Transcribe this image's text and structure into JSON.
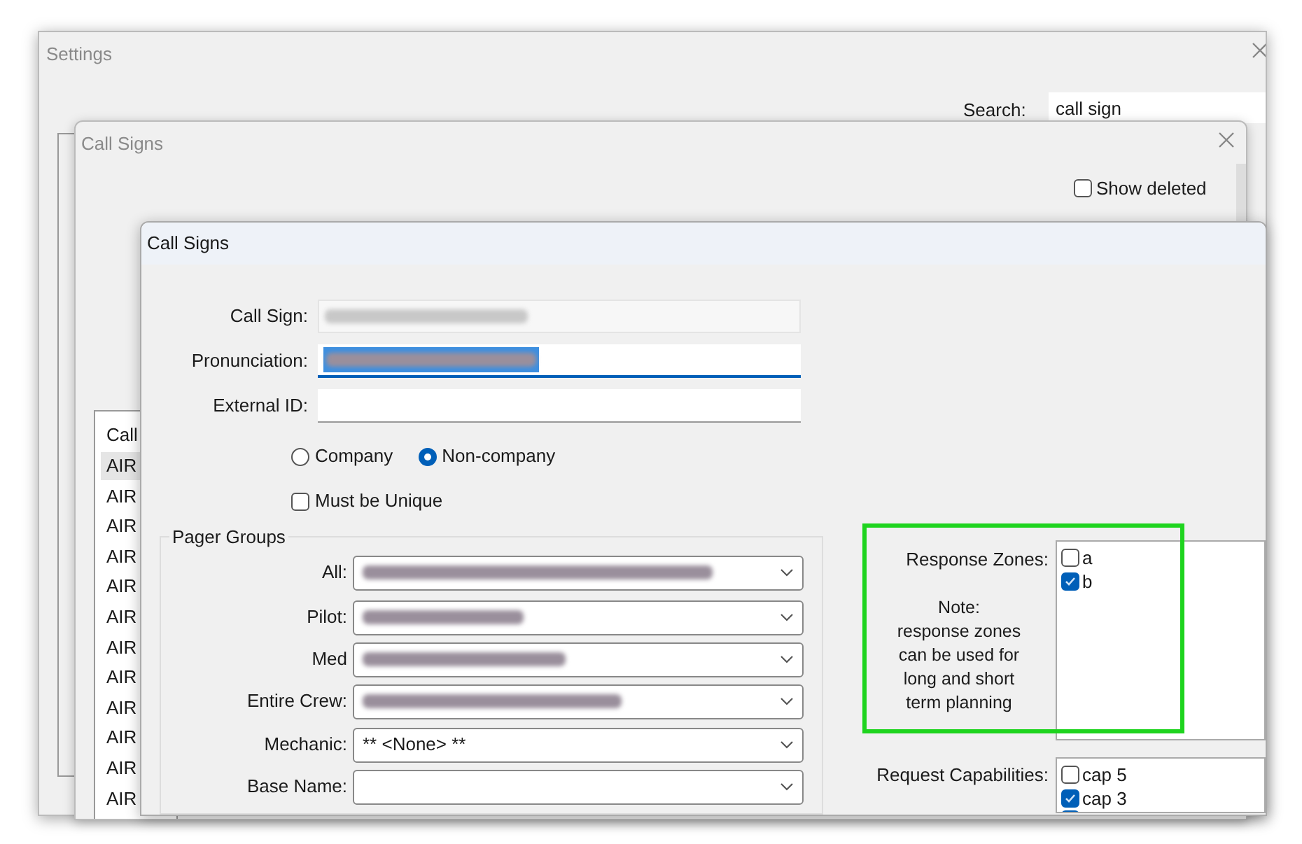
{
  "settings_window": {
    "title": "Settings",
    "search": {
      "label": "Search:",
      "value": "call sign"
    }
  },
  "call_signs_window": {
    "title": "Call Signs",
    "show_deleted": {
      "label": "Show deleted",
      "checked": false
    },
    "list": {
      "header": "Call",
      "rows": [
        {
          "text": "AIR",
          "selected": true
        },
        {
          "text": "AIR",
          "selected": false
        },
        {
          "text": "AIR",
          "selected": false
        },
        {
          "text": "AIR",
          "selected": false
        },
        {
          "text": "AIR",
          "selected": false
        },
        {
          "text": "AIR",
          "selected": false
        },
        {
          "text": "AIR",
          "selected": false
        },
        {
          "text": "AIR",
          "selected": false
        },
        {
          "text": "AIR",
          "selected": false
        },
        {
          "text": "AIR",
          "selected": false
        },
        {
          "text": "AIR",
          "selected": false
        },
        {
          "text": "AIR",
          "selected": false
        }
      ]
    }
  },
  "dialog": {
    "title": "Call Signs",
    "fields": [
      {
        "label": "Call Sign:",
        "kind": "readonly",
        "redacted": true
      },
      {
        "label": "Pronunciation:",
        "kind": "focused",
        "redacted": true
      },
      {
        "label": "External ID:",
        "kind": "text",
        "redacted": false
      }
    ],
    "ownership": [
      {
        "label": "Company",
        "selected": false
      },
      {
        "label": "Non-company",
        "selected": true
      }
    ],
    "must_be_unique": {
      "label": "Must be Unique",
      "checked": false
    },
    "pager_groups": {
      "title": "Pager Groups",
      "rows": [
        {
          "label": "All:",
          "redacted": true
        },
        {
          "label": "Pilot:",
          "redacted": true
        },
        {
          "label": "Med",
          "redacted": true
        },
        {
          "label": "Entire Crew:",
          "redacted": true
        },
        {
          "label": "Mechanic:",
          "value": "** <None> **"
        },
        {
          "label": "Base Name:"
        }
      ]
    },
    "response_zones": {
      "label": "Response Zones:",
      "note": "Note:\nresponse zones\ncan be used for\nlong and short\nterm planning",
      "highlighted": true,
      "items": [
        {
          "label": "a",
          "checked": false
        },
        {
          "label": "b",
          "checked": true
        }
      ]
    },
    "request_capabilities": {
      "label": "Request Capabilities:",
      "items": [
        {
          "label": "cap 5",
          "checked": false
        },
        {
          "label": "cap 3",
          "checked": true
        },
        {
          "checked": true
        }
      ]
    }
  }
}
